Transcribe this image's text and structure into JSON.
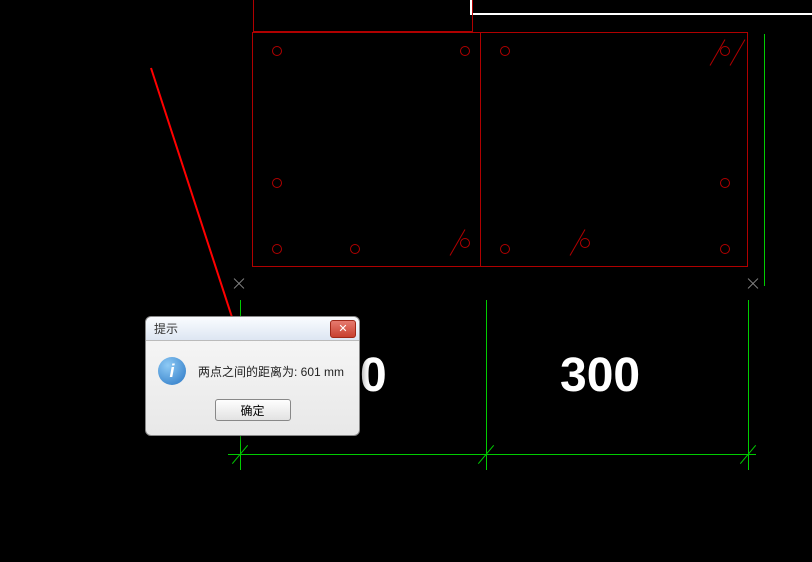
{
  "drawing": {
    "dim_left": "0",
    "dim_right": "300"
  },
  "dialog": {
    "title": "提示",
    "message": "两点之间的距离为: 601 mm",
    "ok_label": "确定"
  }
}
